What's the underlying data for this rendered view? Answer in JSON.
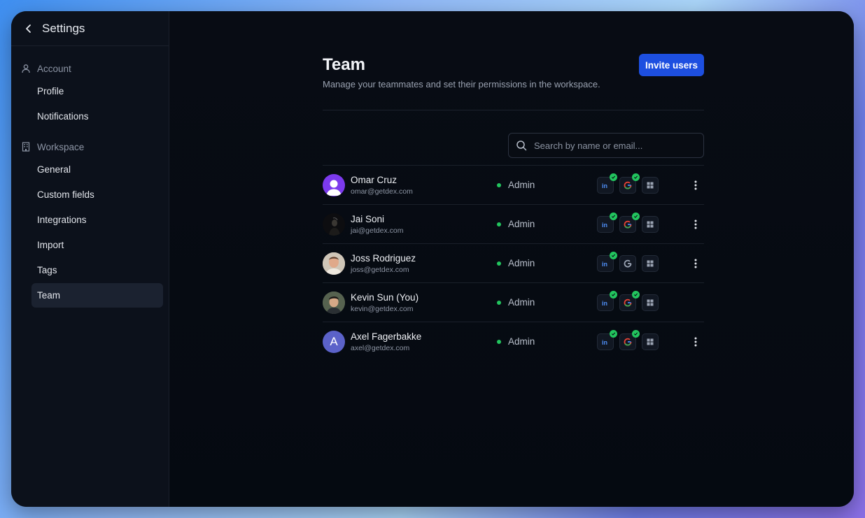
{
  "sidebar": {
    "title": "Settings",
    "account_label": "Account",
    "account_items": [
      "Profile",
      "Notifications"
    ],
    "workspace_label": "Workspace",
    "workspace_items": [
      "General",
      "Custom fields",
      "Integrations",
      "Import",
      "Tags",
      "Team"
    ],
    "active_item": "Team"
  },
  "main": {
    "title": "Team",
    "subtitle": "Manage your teammates and set their permissions in the workspace.",
    "invite_label": "Invite users",
    "search_placeholder": "Search by name or email..."
  },
  "colors": {
    "accent": "#1d4fe0",
    "status_green": "#22c55e"
  },
  "members": [
    {
      "name": "Omar Cruz",
      "email": "omar@getdex.com",
      "role": "Admin",
      "avatar": "placeholder-person-icon",
      "linkedin_connected": true,
      "google_connected": true,
      "has_menu": true
    },
    {
      "name": "Jai Soni",
      "email": "jai@getdex.com",
      "role": "Admin",
      "avatar": "photo",
      "linkedin_connected": true,
      "google_connected": true,
      "has_menu": true
    },
    {
      "name": "Joss Rodriguez",
      "email": "joss@getdex.com",
      "role": "Admin",
      "avatar": "photo",
      "linkedin_connected": true,
      "google_connected": false,
      "has_menu": true
    },
    {
      "name": "Kevin Sun (You)",
      "email": "kevin@getdex.com",
      "role": "Admin",
      "avatar": "photo",
      "linkedin_connected": true,
      "google_connected": true,
      "has_menu": false
    },
    {
      "name": "Axel Fagerbakke",
      "email": "axel@getdex.com",
      "role": "Admin",
      "avatar": "initial",
      "initial": "A",
      "linkedin_connected": true,
      "google_connected": true,
      "has_menu": true
    }
  ]
}
